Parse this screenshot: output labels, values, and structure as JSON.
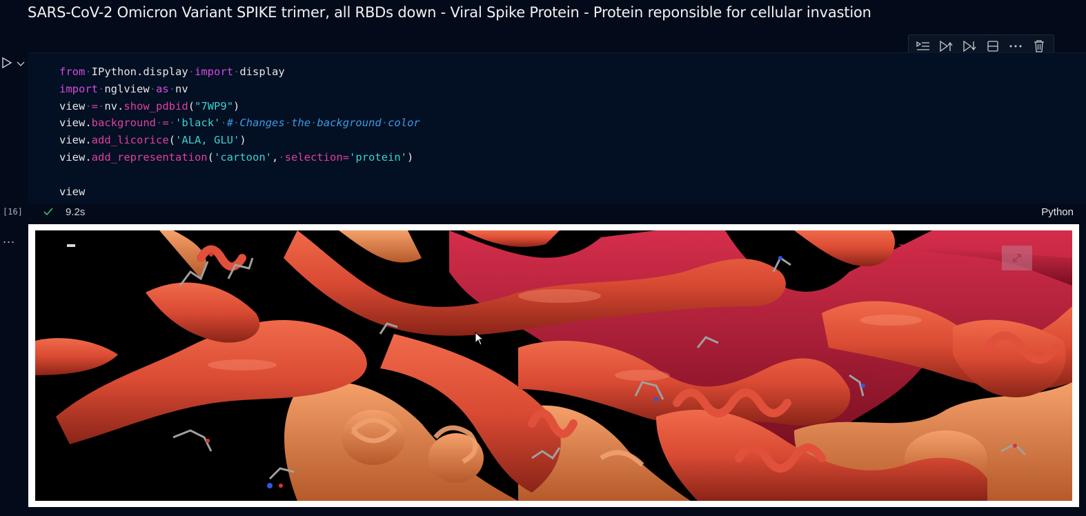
{
  "markdown": {
    "title": "SARS-CoV-2 Omicron Variant SPIKE trimer, all RBDs down - Viral Spike Protein - Protein reponsible for cellular invastion"
  },
  "cell_toolbar": {
    "icons": [
      "run-by-line-icon",
      "execute-above-icon",
      "execute-below-icon",
      "split-cell-icon",
      "more-actions-icon",
      "delete-cell-icon"
    ]
  },
  "code_cell": {
    "lines": [
      "from IPython.display import display",
      "import nglview as nv",
      "view = nv.show_pdbid(\"7WP9\")",
      "view.background = 'black' # Changes the background color",
      "view.add_licorice('ALA, GLU')",
      "view.add_representation('cartoon', selection='protein')",
      "",
      "view"
    ],
    "execution_count": "[16]",
    "execution_time": "9.2s",
    "language": "Python"
  },
  "output": {
    "more_label": "...",
    "viewer_background": "#000000",
    "colors": {
      "chain_a": "#d94a33",
      "chain_b": "#c41e3a",
      "chain_c": "#e88a50",
      "licorice": "#9a9a9a"
    }
  },
  "theme": {
    "background": "#030b1a",
    "keyword": "#d34ae0",
    "string": "#36d4d4",
    "comment": "#3b9be8"
  }
}
